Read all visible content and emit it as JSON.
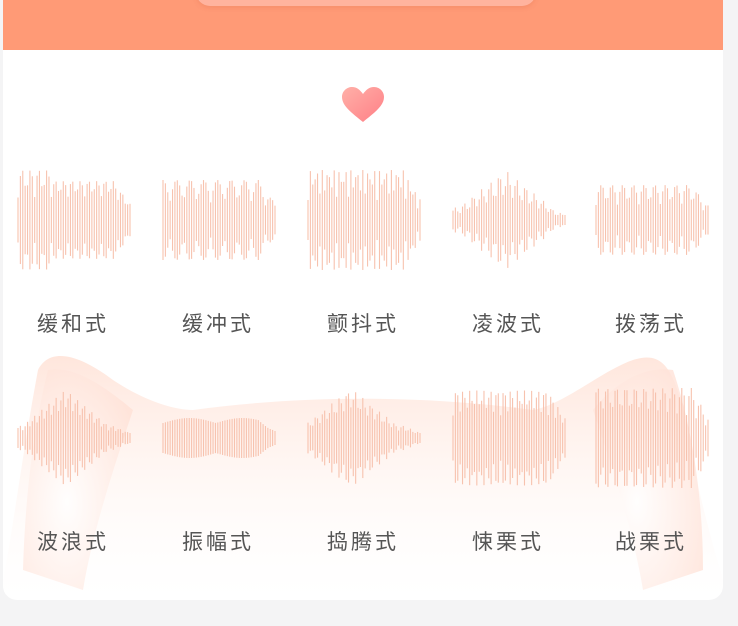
{
  "colors": {
    "accent": "#ff9a76",
    "wave": "#f7c2ae",
    "heart": "#ff8f8f",
    "label": "#555555"
  },
  "header": {
    "icon": "heart-icon"
  },
  "modes": [
    {
      "label": "缓和式",
      "icon": "waveform-icon"
    },
    {
      "label": "缓冲式",
      "icon": "waveform-icon"
    },
    {
      "label": "颤抖式",
      "icon": "waveform-icon"
    },
    {
      "label": "凌波式",
      "icon": "waveform-icon"
    },
    {
      "label": "拨荡式",
      "icon": "waveform-icon"
    },
    {
      "label": "波浪式",
      "icon": "waveform-icon"
    },
    {
      "label": "振幅式",
      "icon": "waveform-icon"
    },
    {
      "label": "捣腾式",
      "icon": "waveform-icon"
    },
    {
      "label": "悚栗式",
      "icon": "waveform-icon"
    },
    {
      "label": "战栗式",
      "icon": "waveform-icon"
    }
  ]
}
